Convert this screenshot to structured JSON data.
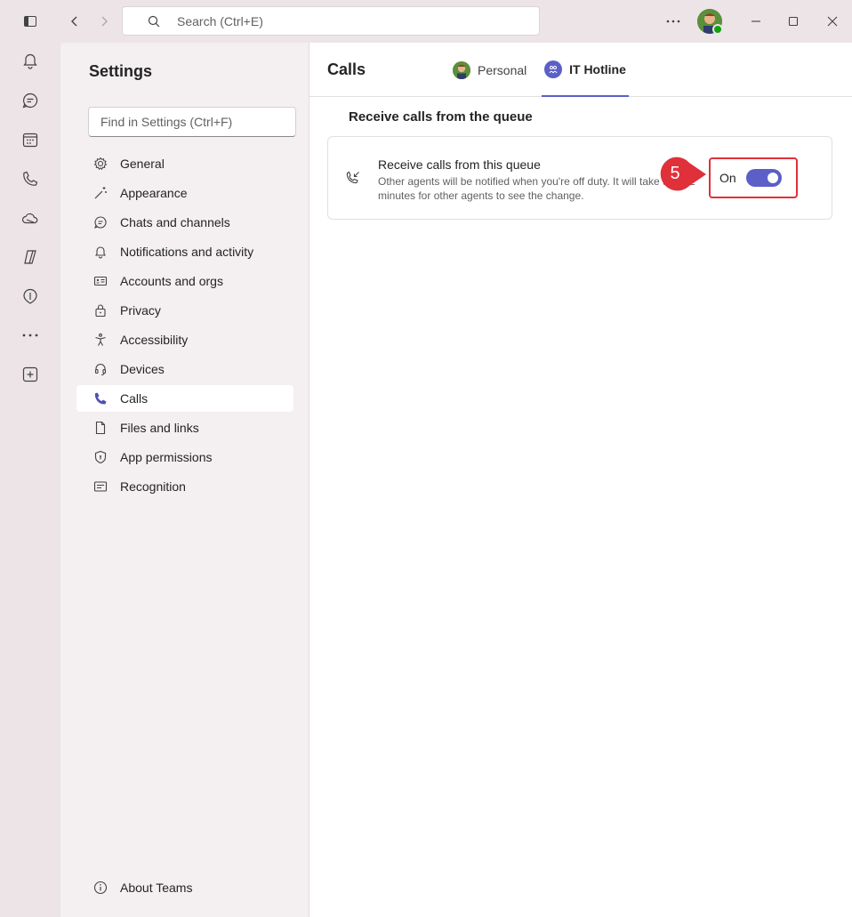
{
  "titlebar": {
    "search_placeholder": "Search (Ctrl+E)"
  },
  "rail": {
    "items": [
      "bell-icon",
      "chat-icon",
      "calendar-icon",
      "phone-icon",
      "onedrive-icon",
      "copilot-icon",
      "viva-icon",
      "more-icon",
      "add-apps-icon"
    ]
  },
  "settings": {
    "title": "Settings",
    "find_placeholder": "Find in Settings (Ctrl+F)",
    "items": [
      {
        "label": "General"
      },
      {
        "label": "Appearance"
      },
      {
        "label": "Chats and channels"
      },
      {
        "label": "Notifications and activity"
      },
      {
        "label": "Accounts and orgs"
      },
      {
        "label": "Privacy"
      },
      {
        "label": "Accessibility"
      },
      {
        "label": "Devices"
      },
      {
        "label": "Calls"
      },
      {
        "label": "Files and links"
      },
      {
        "label": "App permissions"
      },
      {
        "label": "Recognition"
      }
    ],
    "active": "Calls",
    "about": "About Teams"
  },
  "main": {
    "title": "Calls",
    "tabs": [
      {
        "label": "Personal"
      },
      {
        "label": "IT Hotline"
      }
    ],
    "active_tab": "IT Hotline",
    "section_title": "Receive calls from the queue",
    "card": {
      "title": "Receive calls from this queue",
      "description": "Other agents will be notified when you're off duty. It will take up to 2 minutes for other agents to see the change.",
      "toggle_label": "On",
      "toggle_state": true
    }
  },
  "annotation": {
    "step": "5",
    "color": "#e0303a"
  },
  "colors": {
    "accent": "#5b5fc7"
  }
}
